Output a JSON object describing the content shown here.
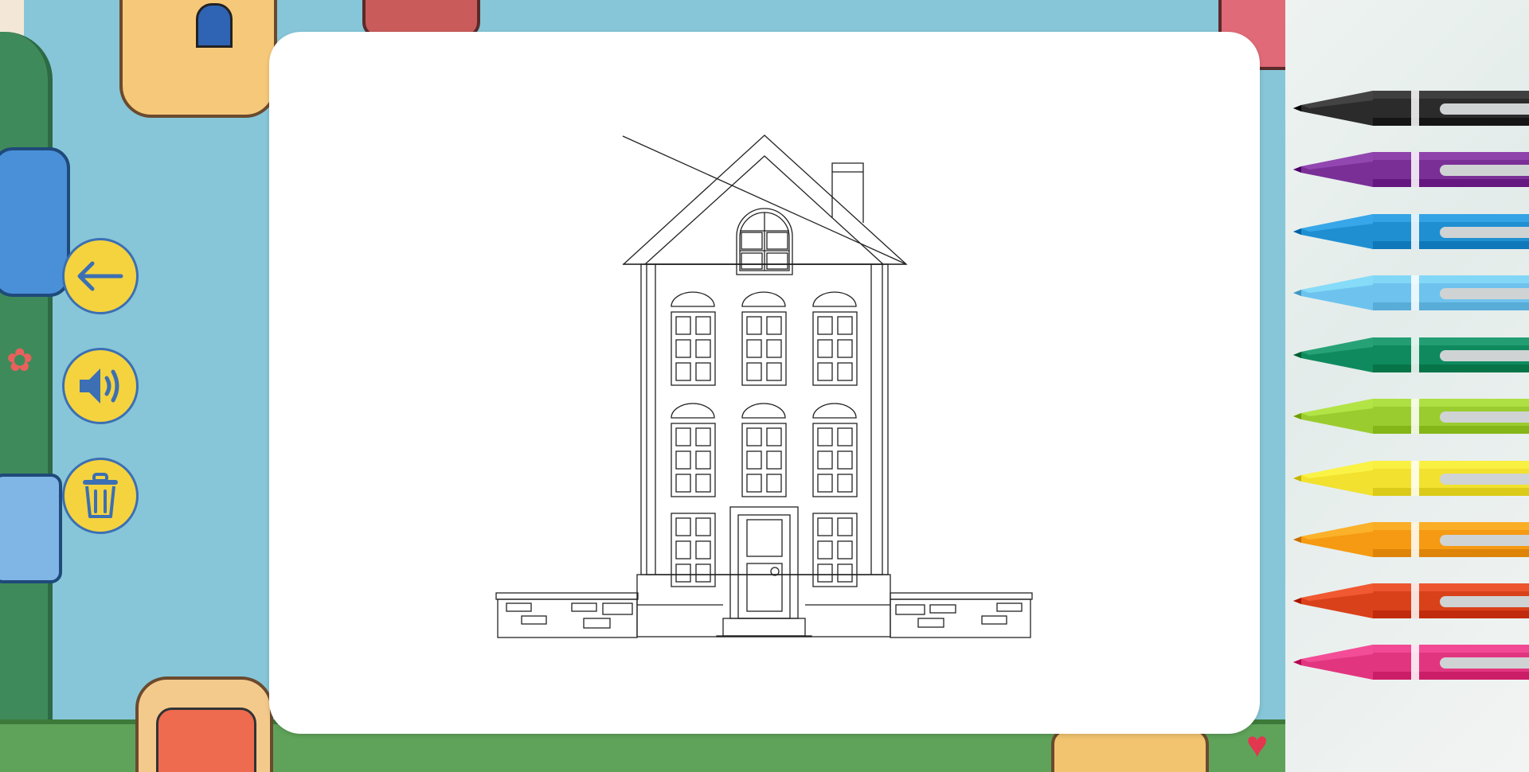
{
  "app": {
    "screen": "coloring-page",
    "drawing_subject": "house-outline"
  },
  "toolbar": {
    "buttons": [
      {
        "name": "back",
        "icon": "arrow-left-icon"
      },
      {
        "name": "sound",
        "icon": "speaker-icon"
      },
      {
        "name": "clear",
        "icon": "trash-icon"
      }
    ],
    "button_color": "#f4d33f",
    "icon_color": "#3c6fb3"
  },
  "palette": {
    "colors": [
      {
        "name": "black",
        "hex": "#2b2b2b"
      },
      {
        "name": "purple",
        "hex": "#7a2f97"
      },
      {
        "name": "blue",
        "hex": "#1f8fd1"
      },
      {
        "name": "light-blue",
        "hex": "#6ec3ee"
      },
      {
        "name": "green",
        "hex": "#0f8a5f"
      },
      {
        "name": "lime",
        "hex": "#9bcc2f"
      },
      {
        "name": "yellow",
        "hex": "#f2e12e"
      },
      {
        "name": "orange",
        "hex": "#f59a12"
      },
      {
        "name": "red",
        "hex": "#d9411a"
      },
      {
        "name": "pink",
        "hex": "#e2357f"
      }
    ]
  }
}
